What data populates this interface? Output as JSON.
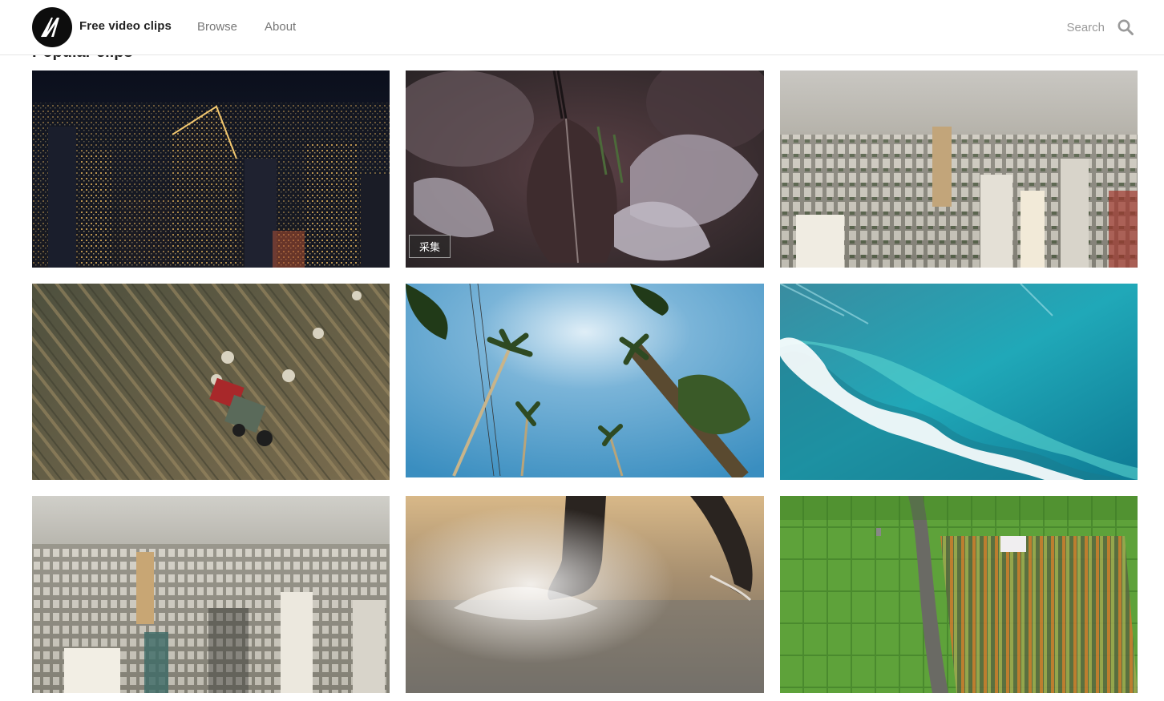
{
  "header": {
    "brand": "Free video clips",
    "nav": [
      {
        "label": "Browse"
      },
      {
        "label": "About"
      }
    ],
    "search": {
      "placeholder": "Search",
      "value": ""
    }
  },
  "section": {
    "title": "Popular clips"
  },
  "tiles": [
    {
      "subject": "night city aerial with skyscrapers"
    },
    {
      "subject": "frosted leaves close-up",
      "badge": "采集"
    },
    {
      "subject": "hazy city skyline aerial"
    },
    {
      "subject": "tractor baling hay field aerial"
    },
    {
      "subject": "palm trees against blue sky"
    },
    {
      "subject": "turquoise ocean wave aerial"
    },
    {
      "subject": "dense city skyline at haze"
    },
    {
      "subject": "feet splashing water at sunset"
    },
    {
      "subject": "green rice field terraces aerial"
    }
  ],
  "icons": {
    "logo": "monogram-logo-icon",
    "search": "search-icon"
  },
  "colors": {
    "brand_text": "#222222",
    "nav_text": "#777777",
    "logo_bg": "#0d0d0d"
  }
}
